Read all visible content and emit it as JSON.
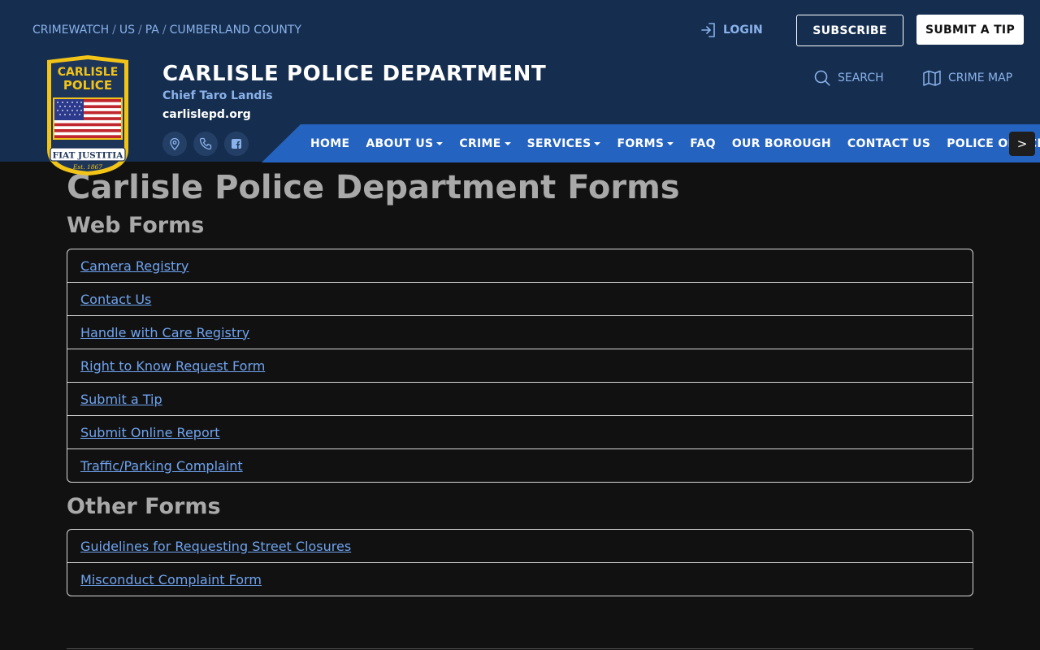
{
  "breadcrumb": [
    "CRIMEWATCH",
    "US",
    "PA",
    "CUMBERLAND COUNTY"
  ],
  "header": {
    "login_label": "LOGIN",
    "subscribe_label": "SUBSCRIBE",
    "submit_tip_label": "SUBMIT A TIP",
    "dept_name": "CARLISLE POLICE DEPARTMENT",
    "chief": "Chief Taro Landis",
    "website": "carlislepd.org",
    "search_label": "SEARCH",
    "crime_map_label": "CRIME MAP"
  },
  "badge": {
    "line1": "CARLISLE",
    "line2": "POLICE",
    "motto": "FIAT JUSTITIA",
    "est": "Est. 1867"
  },
  "social_icons": [
    "location-pin-icon",
    "phone-icon",
    "facebook-icon"
  ],
  "nav": {
    "items": [
      {
        "label": "HOME",
        "dropdown": false
      },
      {
        "label": "ABOUT US",
        "dropdown": true
      },
      {
        "label": "CRIME",
        "dropdown": true
      },
      {
        "label": "SERVICES",
        "dropdown": true
      },
      {
        "label": "FORMS",
        "dropdown": true
      },
      {
        "label": "FAQ",
        "dropdown": false
      },
      {
        "label": "OUR BOROUGH",
        "dropdown": false
      },
      {
        "label": "CONTACT US",
        "dropdown": false
      },
      {
        "label": "POLICE OFFICERS",
        "dropdown": false
      }
    ],
    "next_label": ">"
  },
  "main": {
    "page_title": "Carlisle Police Department Forms",
    "web_forms_title": "Web Forms",
    "web_forms": [
      "Camera Registry",
      "Contact Us",
      "Handle with Care Registry",
      "Right to Know Request Form",
      "Submit a Tip",
      "Submit Online Report",
      "Traffic/Parking Complaint"
    ],
    "other_forms_title": "Other Forms",
    "other_forms": [
      "Guidelines for Requesting Street Closures",
      "Misconduct Complaint Form"
    ]
  },
  "colors": {
    "header_bg": "#152d4f",
    "nav_bg": "#2563c0",
    "page_bg": "#111111",
    "link": "#6fa3ef",
    "badge_gold": "#f2c418"
  }
}
